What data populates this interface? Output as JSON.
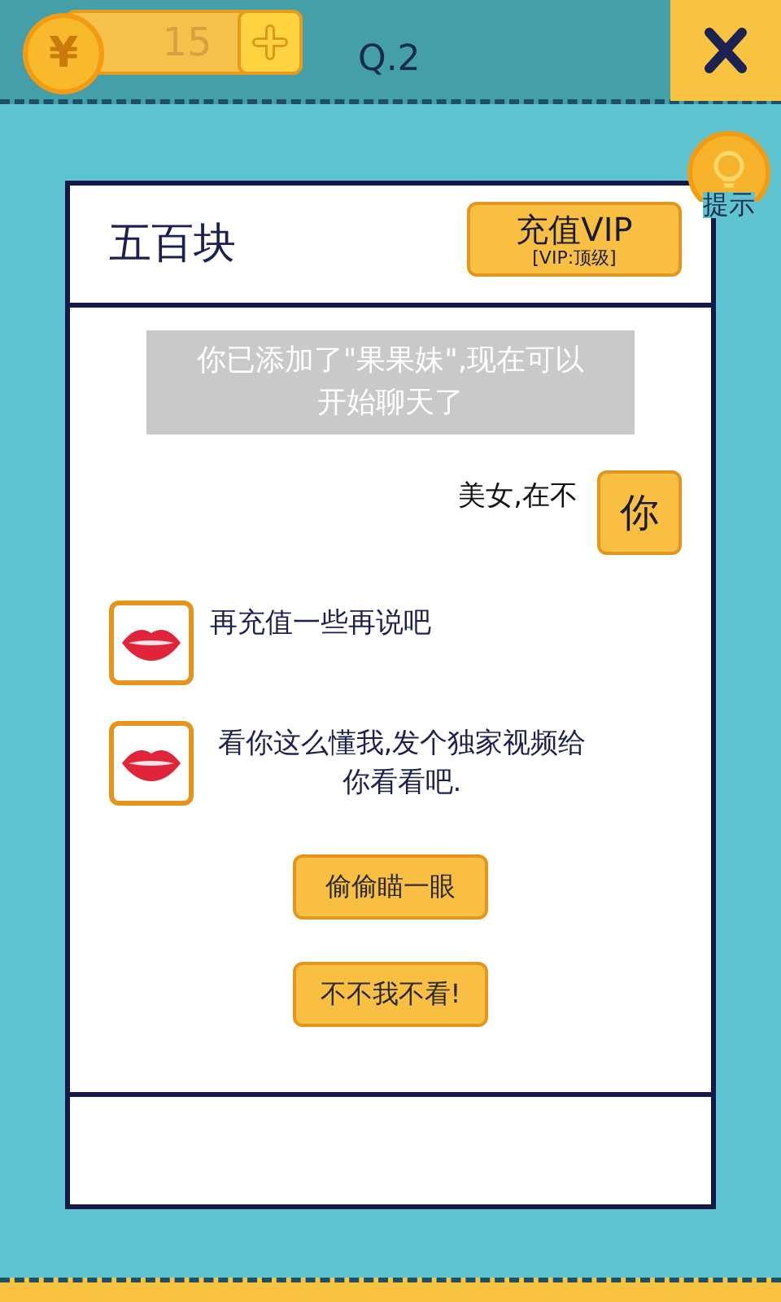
{
  "top_bar": {
    "coin_symbol": "¥",
    "coins": "15",
    "question": "Q.2"
  },
  "hint": {
    "label": "提示"
  },
  "chat": {
    "title": "五百块",
    "vip_button": {
      "label": "充值VIP",
      "sublabel": "[VIP:顶级]"
    },
    "messages": [
      {
        "kind": "system",
        "text": "你已添加了\"果果妹\",现在可以开始聊天了"
      },
      {
        "kind": "sent",
        "text": "美女,在不",
        "avatar": "你"
      },
      {
        "kind": "received",
        "text": "再充值一些再说吧"
      },
      {
        "kind": "received",
        "text": "看你这么懂我,发个独家视频给你看看吧."
      }
    ],
    "options": [
      "偷偷瞄一眼",
      "不不我不看!"
    ]
  }
}
